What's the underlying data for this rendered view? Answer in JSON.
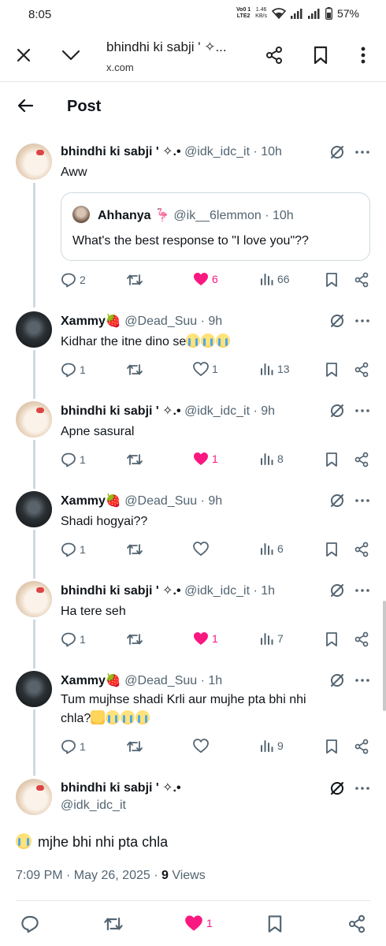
{
  "status_bar": {
    "time": "8:05",
    "network_tag_top": "Vo0 1",
    "network_tag_bottom": "LTE2",
    "speed_top": "1.46",
    "speed_bottom": "KB/s",
    "battery": "57%"
  },
  "browser": {
    "title": "bhindhi ki sabji ' ✧...",
    "url": "x.com"
  },
  "header": {
    "title": "Post"
  },
  "quote": {
    "name": "Ahhanya 🦩",
    "meta": "@ik__6lemmon · 10h",
    "text": "What's the best response to \"I love you\"??"
  },
  "replies": [
    {
      "name": "bhindhi ki sabji ' ✧.•",
      "meta": "@idk_idc_it · 10h",
      "text": "Aww",
      "emojis": [],
      "actions": {
        "replies": "2",
        "likes": "6",
        "views": "66",
        "liked": true
      }
    },
    {
      "name": "Xammy🍓",
      "meta": "@Dead_Suu · 9h",
      "text": "Kidhar the itne dino se",
      "emojis": [
        "loudly-crying",
        "loudly-crying",
        "loudly-crying"
      ],
      "actions": {
        "replies": "1",
        "likes": "1",
        "views": "13",
        "liked": false
      }
    },
    {
      "name": "bhindhi ki sabji ' ✧.•",
      "meta": "@idk_idc_it · 9h",
      "text": "Apne sasural",
      "emojis": [],
      "actions": {
        "replies": "1",
        "likes": "1",
        "views": "8",
        "liked": true
      }
    },
    {
      "name": "Xammy🍓",
      "meta": "@Dead_Suu · 9h",
      "text": "Shadi hogyai??",
      "emojis": [],
      "actions": {
        "replies": "1",
        "likes": "",
        "views": "6",
        "liked": false
      }
    },
    {
      "name": "bhindhi ki sabji ' ✧.•",
      "meta": "@idk_idc_it · 1h",
      "text": "Ha tere seh",
      "emojis": [],
      "actions": {
        "replies": "1",
        "likes": "1",
        "views": "7",
        "liked": true
      }
    },
    {
      "name": "Xammy🍓",
      "meta": "@Dead_Suu · 1h",
      "text_line1": "Tum mujhse shadi Krli aur mujhe pta bhi nhi",
      "text_line2": "chla?",
      "emojis": [
        "screaming",
        "loudly-crying",
        "loudly-crying",
        "loudly-crying"
      ],
      "actions": {
        "replies": "1",
        "likes": "",
        "views": "9",
        "liked": false
      }
    }
  ],
  "main_post": {
    "name": "bhindhi ki sabji ' ✧.•",
    "handle": "@idk_idc_it",
    "text": "mjhe bhi nhi pta chla",
    "emoji": "loudly-crying",
    "timestamp": "7:09 PM · May 26, 2025 · ",
    "views_count": "9",
    "views_label": " Views",
    "likes": "1"
  },
  "colors": {
    "text": "#0f1419",
    "secondary": "#536471",
    "like": "#f91880",
    "border": "#cfd9de"
  },
  "icons": [
    "close-icon",
    "chevron-down-icon",
    "share-icon",
    "bookmark-icon",
    "more-vertical-icon",
    "back-arrow-icon",
    "grok-icon",
    "more-horizontal-icon",
    "reply-icon",
    "repost-icon",
    "heart-icon",
    "views-icon"
  ]
}
